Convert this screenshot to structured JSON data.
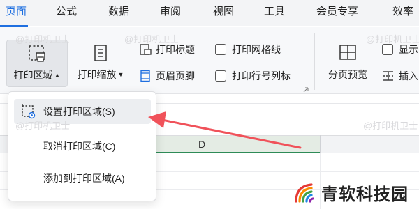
{
  "menu": {
    "tabs": [
      {
        "label": "页面",
        "active": true
      },
      {
        "label": "公式"
      },
      {
        "label": "数据"
      },
      {
        "label": "审阅"
      },
      {
        "label": "视图"
      },
      {
        "label": "工具"
      },
      {
        "label": "会员专享"
      },
      {
        "label": "效率"
      }
    ]
  },
  "ribbon": {
    "print_area": {
      "label": "打印区域",
      "icon": "print-area-icon"
    },
    "print_scale": {
      "label": "打印缩放",
      "icon": "print-scale-icon"
    },
    "print_titles": {
      "label": "打印标题",
      "icon": "print-titles-icon"
    },
    "header_footer": {
      "label": "页眉页脚",
      "icon": "header-footer-icon"
    },
    "print_gridlines": {
      "label": "打印网格线",
      "checked": false
    },
    "print_row_col_headers": {
      "label": "打印行号列标",
      "checked": false
    },
    "page_break_preview": {
      "label": "分页预览",
      "icon": "page-break-preview-icon"
    },
    "show_partial": {
      "label": "显示",
      "checked": false
    },
    "insert_partial": {
      "label": "插入",
      "icon": "insert-page-break-icon"
    }
  },
  "sheet": {
    "column_header": "D"
  },
  "dropdown": {
    "items": [
      {
        "label": "设置打印区域(S)",
        "icon": "set-print-area-icon",
        "highlighted": true
      },
      {
        "label": "取消打印区域(C)"
      },
      {
        "label": "添加到打印区域(A)"
      }
    ]
  },
  "watermark": {
    "text": "@打印机卫士"
  },
  "brand": {
    "name": "青软科技园"
  },
  "colors": {
    "accent": "#1f6fe0",
    "arrow": "#f0525a",
    "column_selected": "#2e8b57"
  }
}
